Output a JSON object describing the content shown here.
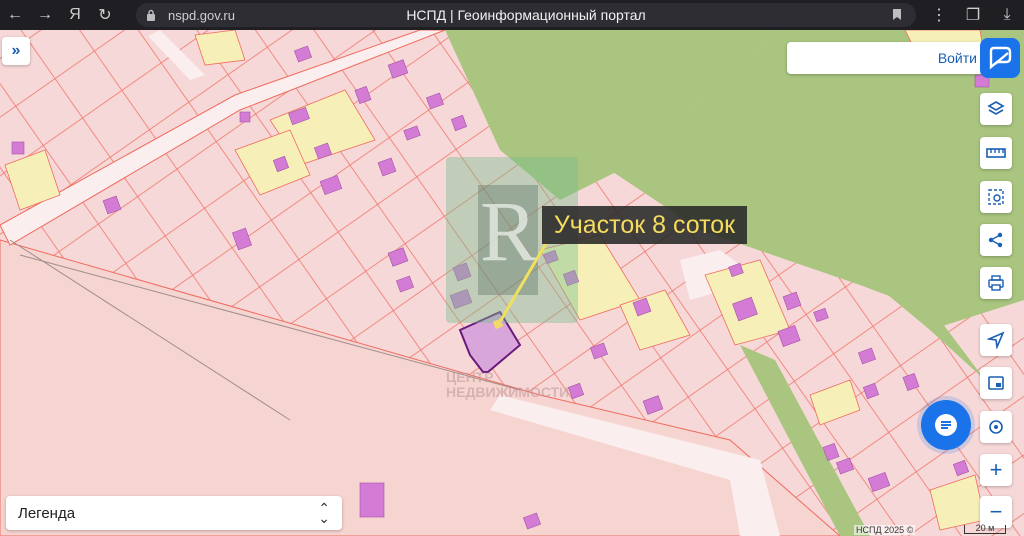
{
  "browser": {
    "url": "nspd.gov.ru",
    "title": "НСПД | Геоинформационный портал"
  },
  "map": {
    "login_label": "Войти",
    "legend_label": "Легенда",
    "annotation": "Участок 8 соток",
    "copyright": "НСПД 2025 ©",
    "scale_label": "20 м",
    "watermark_line1": "ЦЕНТР",
    "watermark_line2": "НЕДВИЖИМОСТИ"
  },
  "colors": {
    "parcel_fill": "#f7d3d3",
    "parcel_line": "#ef6b5e",
    "selected_yellow": "#f6f0b8",
    "building": "#d47bd6",
    "green": "#a9c57f",
    "road": "#fbeeee",
    "accent": "#1a73e8"
  },
  "toolbar": {
    "icons": [
      "layers-icon",
      "ruler-icon",
      "select-area-icon",
      "share-icon",
      "print-icon",
      "navigate-icon",
      "minimap-icon",
      "location-icon",
      "zoom-in-icon",
      "zoom-out-icon"
    ]
  }
}
